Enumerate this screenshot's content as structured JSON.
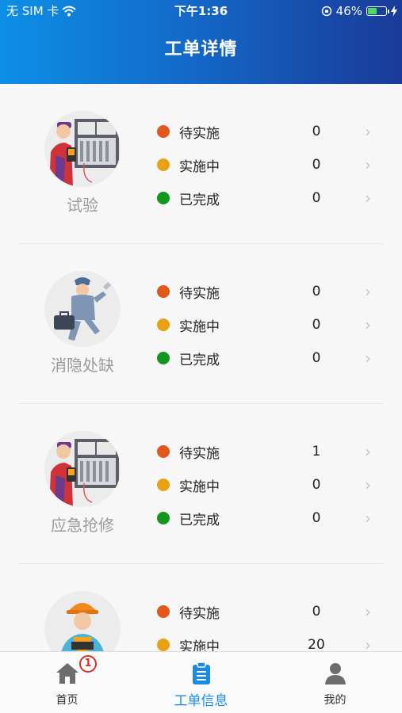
{
  "status_bar": {
    "carrier": "无 SIM 卡",
    "time": "下午1:36",
    "battery": "46%"
  },
  "header": {
    "title": "工单详情"
  },
  "status_labels": {
    "pending": "待实施",
    "doing": "实施中",
    "done": "已完成"
  },
  "sections": [
    {
      "name": "试验",
      "icon": "technician-electric-panel-icon",
      "counts": {
        "pending": "0",
        "doing": "0",
        "done": "0"
      }
    },
    {
      "name": "消隐处缺",
      "icon": "repairman-toolbox-icon",
      "counts": {
        "pending": "0",
        "doing": "0",
        "done": "0"
      }
    },
    {
      "name": "应急抢修",
      "icon": "technician-electric-panel-icon",
      "counts": {
        "pending": "1",
        "doing": "0",
        "done": "0"
      }
    },
    {
      "name": "",
      "icon": "worker-hardhat-icon",
      "counts": {
        "pending": "0",
        "doing": "20"
      }
    }
  ],
  "tabbar": {
    "home_label": "首页",
    "home_badge": "1",
    "orders_label": "工单信息",
    "mine_label": "我的"
  },
  "colors": {
    "pending": "#e2571b",
    "doing": "#e8a115",
    "done": "#11961e",
    "accent": "#1a8ae6"
  }
}
